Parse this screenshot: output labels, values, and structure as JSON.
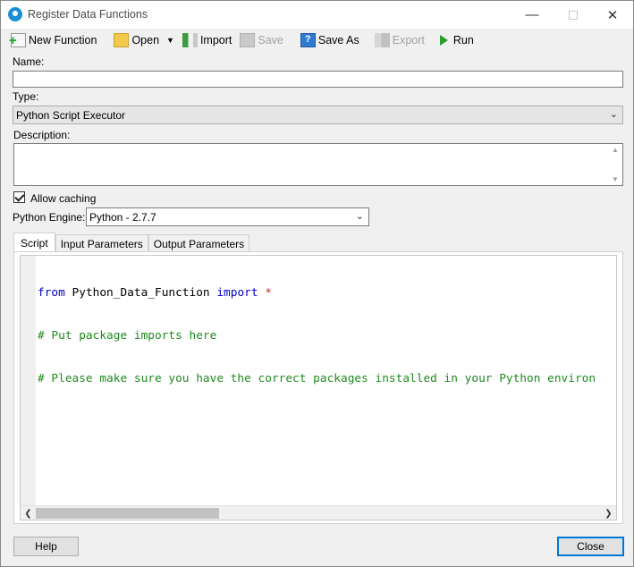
{
  "window": {
    "title": "Register Data Functions",
    "controls": {
      "minimize": "—",
      "close": "✕"
    }
  },
  "toolbar": {
    "new_function": "New Function",
    "open": "Open",
    "import": "Import",
    "save": "Save",
    "save_as": "Save As",
    "export": "Export",
    "run": "Run"
  },
  "form": {
    "name_label": "Name:",
    "name_value": "",
    "type_label": "Type:",
    "type_value": "Python Script Executor",
    "description_label": "Description:",
    "description_value": "",
    "allow_caching_label": "Allow caching",
    "allow_caching_checked": true,
    "engine_label": "Python Engine:",
    "engine_value": "Python - 2.7.7"
  },
  "tabs": [
    {
      "label": "Script",
      "active": true
    },
    {
      "label": "Input Parameters",
      "active": false
    },
    {
      "label": "Output Parameters",
      "active": false
    }
  ],
  "script": {
    "line1_kw1": "from",
    "line1_module": " Python_Data_Function ",
    "line1_kw2": "import",
    "line1_star": " *",
    "line2": "# Put package imports here",
    "line3": "# Please make sure you have the correct packages installed in your Python environ"
  },
  "footer": {
    "help": "Help",
    "close": "Close"
  },
  "colors": {
    "keyword": "#0000c8",
    "comment": "#1f8a1f",
    "accent": "#0078d7"
  }
}
